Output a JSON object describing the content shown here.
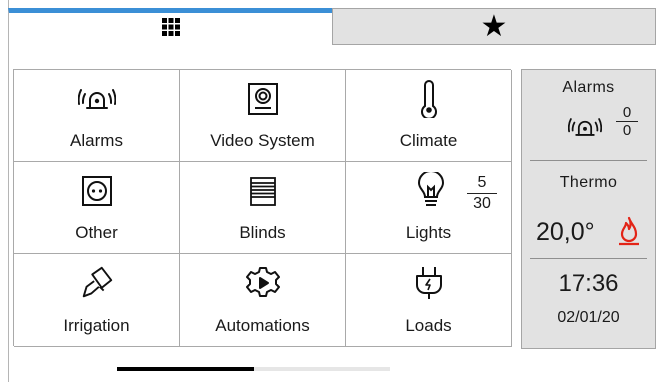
{
  "tabs": {
    "home": {
      "icon": "grid-icon",
      "active": true,
      "accent_color": "#3b8fd6"
    },
    "favorites": {
      "icon": "star-icon",
      "glyph": "★"
    }
  },
  "tiles": [
    {
      "label": "Alarms",
      "icon": "alarm-siren-icon"
    },
    {
      "label": "Video System",
      "icon": "video-intercom-icon"
    },
    {
      "label": "Climate",
      "icon": "thermometer-icon"
    },
    {
      "label": "Other",
      "icon": "socket-icon"
    },
    {
      "label": "Blinds",
      "icon": "blinds-icon"
    },
    {
      "label": "Lights",
      "icon": "lightbulb-icon",
      "counter": {
        "on": "5",
        "total": "30"
      }
    },
    {
      "label": "Irrigation",
      "icon": "watering-can-icon"
    },
    {
      "label": "Automations",
      "icon": "automation-gear-icon"
    },
    {
      "label": "Loads",
      "icon": "plug-icon"
    }
  ],
  "panel": {
    "alarms_title": "Alarms",
    "alarms_active": "0",
    "alarms_total": "0",
    "thermo_title": "Thermo",
    "temperature": "20,0°",
    "heating_icon": "flame-icon",
    "heating_color": "#e32417",
    "time": "17:36",
    "date": "02/01/20",
    "background": "#e2e2e2"
  },
  "pager": {
    "page": 1,
    "pages": 2
  }
}
